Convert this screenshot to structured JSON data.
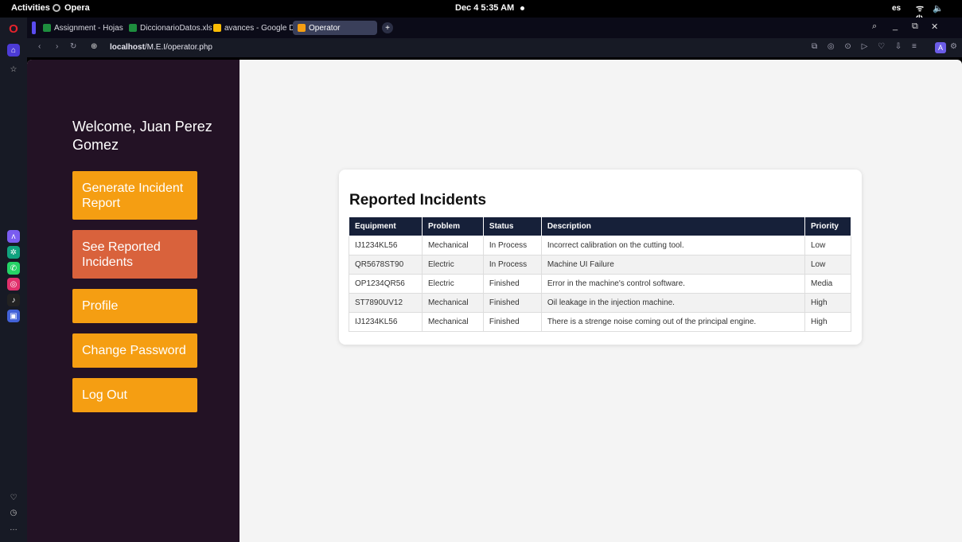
{
  "topbar": {
    "activities": "Activities",
    "app_name": "Opera",
    "clock": "Dec 4  5:35 AM",
    "language": "es",
    "system_icons": "ᯤ 🔈 ⏻"
  },
  "tabs": [
    {
      "label": "Assignment - Hojas",
      "favicon_color": "#1e8e3e"
    },
    {
      "label": "DiccionarioDatos.xls",
      "favicon_color": "#1e8e3e"
    },
    {
      "label": "avances - Google Dr",
      "favicon_color": "#fbbc04"
    },
    {
      "label": "Operator",
      "favicon_color": "#f59e12"
    }
  ],
  "window_controls": {
    "search": "⌕",
    "minimize": "_",
    "restore": "⧉",
    "close": "✕"
  },
  "addressbar": {
    "back": "‹",
    "forward": "›",
    "reload": "↻",
    "site_icon": "⊕",
    "url_host": "localhost",
    "url_path": "/M.E.I/operator.php",
    "tools": "⧉ ◎ ⊙ ▷ ♡ ⇩ ≡",
    "profile_badge": "A",
    "extensions": "⚙"
  },
  "opera_sidebar": {
    "logo": "O",
    "home_icon": "⌂",
    "bookmarks_icon": "☆",
    "apps": [
      {
        "name": "aria-icon",
        "color": "#7a5cf0",
        "glyph": "ᴧ"
      },
      {
        "name": "chatgpt-icon",
        "color": "#10a37f",
        "glyph": "✲"
      },
      {
        "name": "whatsapp-icon",
        "color": "#25d366",
        "glyph": "✆"
      },
      {
        "name": "instagram-icon",
        "color": "#e1306c",
        "glyph": "◎"
      },
      {
        "name": "tiktok-icon",
        "color": "#222222",
        "glyph": "♪"
      },
      {
        "name": "app-icon",
        "color": "#4262d8",
        "glyph": "▣"
      }
    ],
    "bottom": {
      "heart": "♡",
      "history": "◷",
      "more": "…"
    }
  },
  "page": {
    "welcome": "Welcome, Juan Perez Gomez",
    "menu": [
      {
        "label": "Generate Incident Report",
        "active": false
      },
      {
        "label": "See Reported Incidents",
        "active": true
      },
      {
        "label": "Profile",
        "active": false
      },
      {
        "label": "Change Password",
        "active": false
      },
      {
        "label": "Log Out",
        "active": false
      }
    ],
    "incidents": {
      "title": "Reported Incidents",
      "columns": [
        "Equipment",
        "Problem",
        "Status",
        "Description",
        "Priority"
      ],
      "rows": [
        [
          "IJ1234KL56",
          "Mechanical",
          "In Process",
          "Incorrect calibration on the cutting tool.",
          "Low"
        ],
        [
          "QR5678ST90",
          "Electric",
          "In Process",
          "Machine UI Failure",
          "Low"
        ],
        [
          "OP1234QR56",
          "Electric",
          "Finished",
          "Error in the machine's control software.",
          "Media"
        ],
        [
          "ST7890UV12",
          "Mechanical",
          "Finished",
          "Oil leakage in the injection machine.",
          "High"
        ],
        [
          "IJ1234KL56",
          "Mechanical",
          "Finished",
          "There is a strenge noise coming out of the principal engine.",
          "High"
        ]
      ]
    }
  },
  "colors": {
    "sidebar_bg": "#231225",
    "button": "#f59e12",
    "button_active": "#d9623c",
    "table_header": "#162039"
  }
}
